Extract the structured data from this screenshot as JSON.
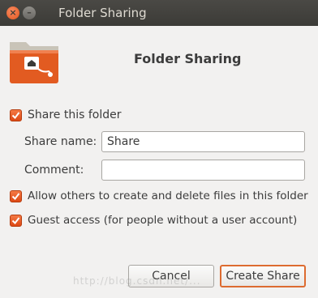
{
  "window": {
    "title": "Folder Sharing",
    "close_glyph": "×",
    "minimize_glyph": "–"
  },
  "header": {
    "title": "Folder Sharing",
    "icon": "shared-folder-icon",
    "accent": "#dd4814"
  },
  "share_checkbox": {
    "label": "Share this folder",
    "checked": true
  },
  "share_name": {
    "label": "Share name:",
    "value": "Share"
  },
  "comment": {
    "label": "Comment:",
    "value": ""
  },
  "allow_others": {
    "label": "Allow others to create and delete files in this folder",
    "checked": true
  },
  "guest_access": {
    "label": "Guest access (for people without a user account)",
    "checked": true
  },
  "buttons": {
    "cancel": "Cancel",
    "create_share": "Create Share"
  },
  "watermark": "http://blog.csdn.net/..."
}
